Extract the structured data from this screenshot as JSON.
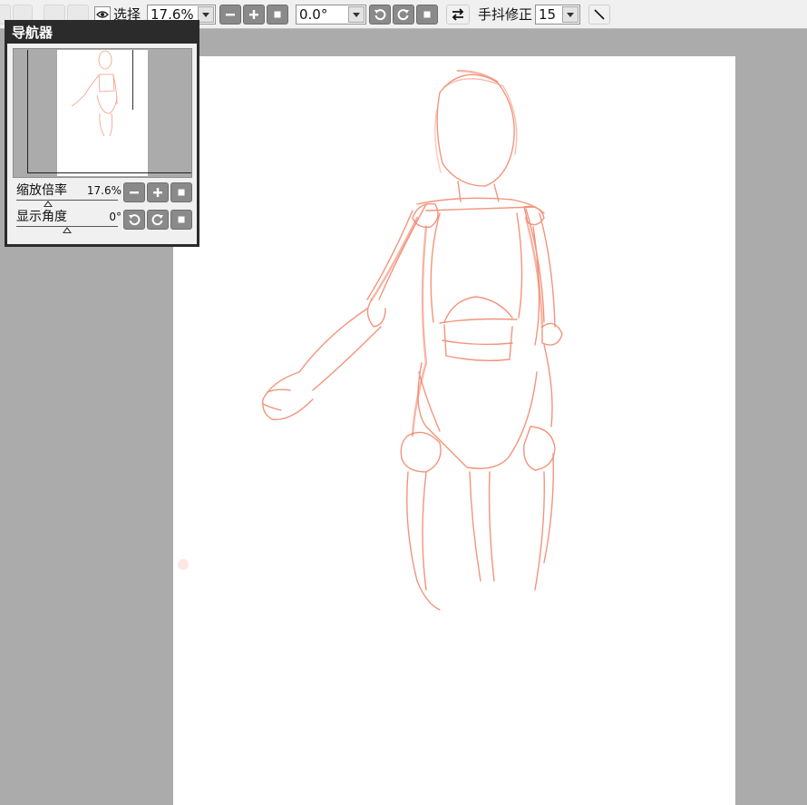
{
  "toolbar": {
    "select_label": "选择",
    "zoom_value": "17.6%",
    "rotation_value": "0.0°",
    "stabilizer_label": "手抖修正",
    "stabilizer_value": "15"
  },
  "navigator": {
    "title": "导航器",
    "zoom_label": "缩放倍率",
    "zoom_value": "17.6%",
    "angle_label": "显示角度",
    "angle_value": "0°"
  },
  "canvas": {
    "background": "#ffffff",
    "stroke_color": "#f07a5c",
    "workspace_color": "#ababab"
  },
  "icons": {
    "zoom_out": "minus-icon",
    "zoom_in": "plus-icon",
    "zoom_reset": "square-icon",
    "rotate_ccw": "rotate-left-icon",
    "rotate_cw": "rotate-right-icon",
    "rotate_reset": "square-icon",
    "flip": "flip-horizontal-icon",
    "visibility": "eye-icon",
    "diagonal": "diagonal-line-icon"
  }
}
